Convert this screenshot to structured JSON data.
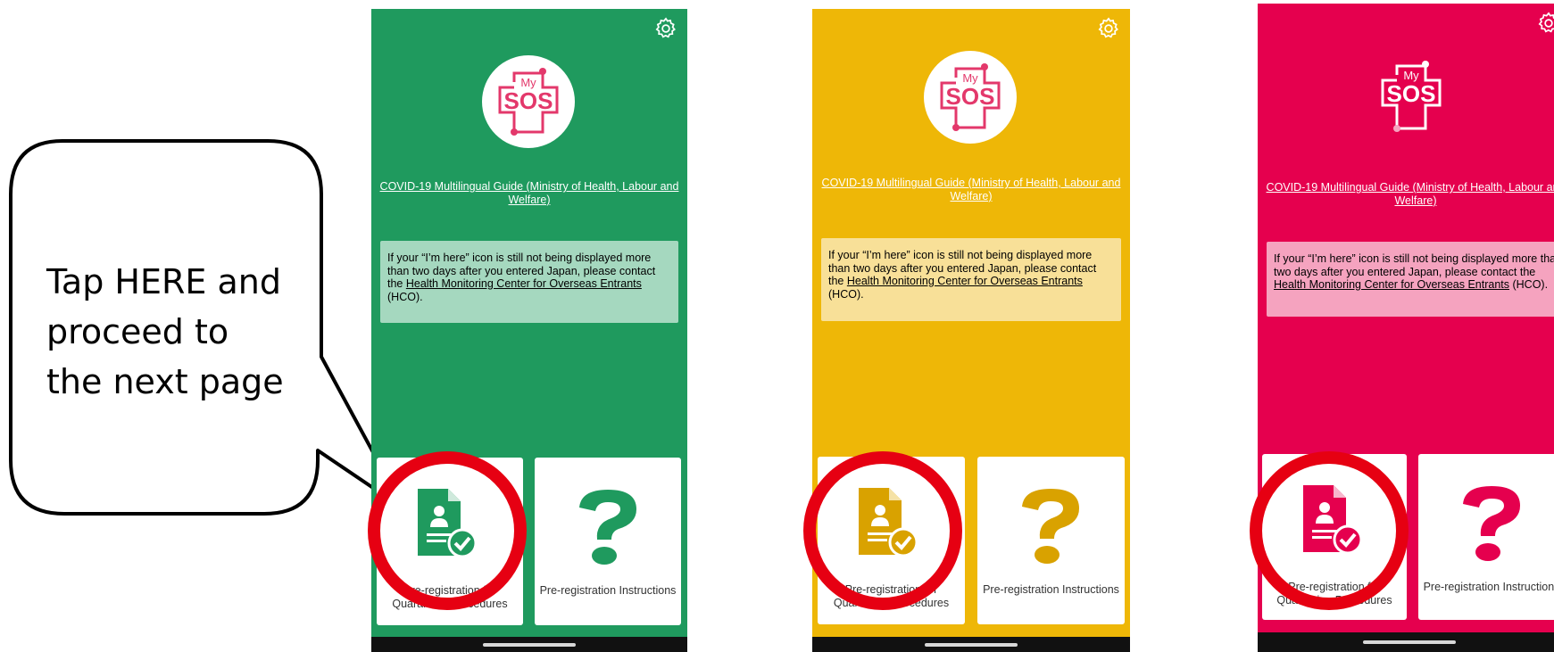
{
  "callout": {
    "text": "Tap HERE and proceed to the next page"
  },
  "colors": {
    "green": "#1f9a5e",
    "yellow": "#eeb707",
    "red": "#e5004e",
    "highlight_ring": "#e60012"
  },
  "screens": [
    {
      "theme": "green",
      "logo_text_top": "My",
      "logo_text_main": "SOS",
      "guide_link": "COVID-19 Multilingual Guide (Ministry of Health, Labour and Welfare)",
      "notice": {
        "before": "If your “I’m here” icon is still not being displayed more than two days after you entered Japan, please contact the ",
        "link": "Health Monitoring Center for Overseas Entrants",
        "after": " (HCO)."
      },
      "card_preregistration": "Pre-registration for Quarantine Procedures",
      "card_instructions": "Pre-registration Instructions"
    },
    {
      "theme": "yellow",
      "logo_text_top": "My",
      "logo_text_main": "SOS",
      "guide_link": "COVID-19 Multilingual Guide (Ministry of Health, Labour and Welfare)",
      "notice": {
        "before": "If your “I’m here” icon is still not being displayed more than two days after you entered Japan, please contact the ",
        "link": "Health Monitoring Center for Overseas Entrants",
        "after": " (HCO)."
      },
      "card_preregistration": "Pre-registration for Quarantine Procedures",
      "card_instructions": "Pre-registration Instructions"
    },
    {
      "theme": "red",
      "logo_text_top": "My",
      "logo_text_main": "SOS",
      "guide_link": "COVID-19 Multilingual Guide (Ministry of Health, Labour and Welfare)",
      "notice": {
        "before": "If your “I’m here” icon is still not being displayed more than two days after you entered Japan, please contact the ",
        "link": "Health Monitoring Center for Overseas Entrants",
        "after": " (HCO)."
      },
      "card_preregistration": "Pre-registration for Quarantine Procedures",
      "card_instructions": "Pre-registration Instructions"
    }
  ]
}
